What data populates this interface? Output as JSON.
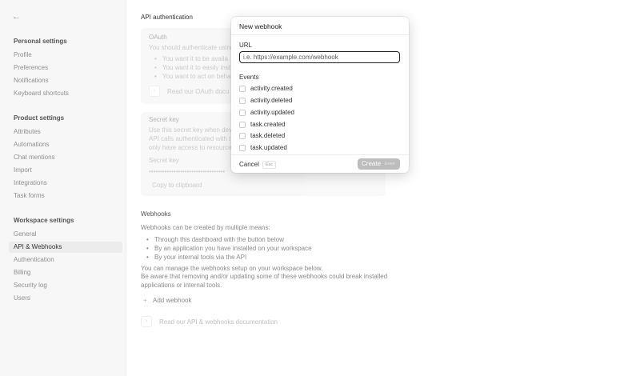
{
  "sidebar": {
    "back_icon": "←",
    "personal_title": "Personal settings",
    "personal_items": [
      "Profile",
      "Preferences",
      "Notifications",
      "Keyboard shortcuts"
    ],
    "product_title": "Product settings",
    "product_items": [
      "Attributes",
      "Automations",
      "Chat mentions",
      "Import",
      "Integrations",
      "Task forms"
    ],
    "workspace_title": "Workspace settings",
    "workspace_items": [
      "General",
      "API & Webhooks",
      "Authentication",
      "Billing",
      "Security log",
      "Users"
    ]
  },
  "main": {
    "api_auth_heading": "API authentication",
    "oauth": {
      "title": "OAuth",
      "intro": "You should authenticate using",
      "bullets": [
        "You want it to be availa",
        "You want it to easily inst",
        "You want to act on beha"
      ],
      "docs_link": "Read our OAuth docu"
    },
    "secret": {
      "title": "Secret key",
      "desc": [
        "Use this secret key when dev",
        "API calls authenticated with t",
        "only have access to resource"
      ],
      "key_label": "Secret key",
      "key_value": "••••••••••••••••••••••••••••••••••",
      "copy": "Copy to clipboard"
    },
    "webhooks": {
      "heading": "Webhooks",
      "intro": "Webhooks can be created by multiple means:",
      "bullets": [
        "Through this dashboard with the button below",
        "By an application you have installed on your workspace",
        "By your internal tools via the API"
      ],
      "manage": "You can manage the webhooks setup on your workspace below.",
      "warning_1": "Be aware that removing and/or updating some of these webhooks could break installed",
      "warning_2": "applications or internal tools.",
      "add": "Add webhook",
      "docs": "Read our API & webhooks documentation"
    }
  },
  "modal": {
    "title": "New webhook",
    "url_label": "URL",
    "url_placeholder": "i.e. https://example.com/webhook",
    "url_value": "",
    "events_label": "Events",
    "events": [
      "activity.created",
      "activity.deleted",
      "activity.updated",
      "task.created",
      "task.deleted",
      "task.updated"
    ],
    "cancel": "Cancel",
    "cancel_key": "Esc",
    "create": "Create",
    "create_key": "Enter"
  }
}
